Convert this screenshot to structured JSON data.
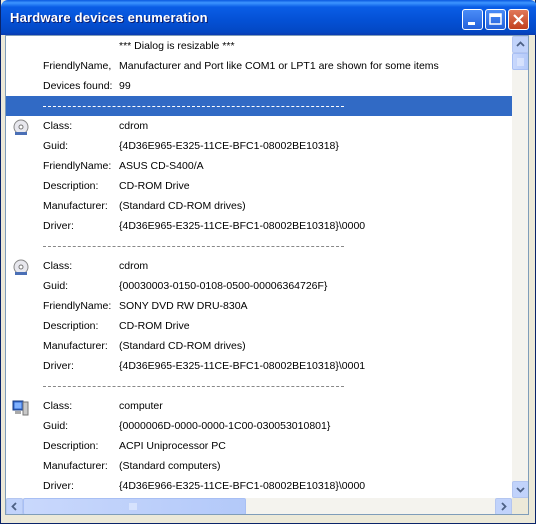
{
  "window": {
    "title": "Hardware devices enumeration"
  },
  "header": [
    {
      "label": "",
      "value": "*** Dialog is resizable ***"
    },
    {
      "label": "FriendlyName,",
      "value": "Manufacturer and Port like COM1 or LPT1 are shown for some items"
    },
    {
      "label": "Devices found:",
      "value": "99"
    }
  ],
  "separator_text": "------------------------------------------------------------------------------------------------------------------------",
  "devices": [
    {
      "icon": "cdrom-icon",
      "fields": [
        {
          "label": "Class:",
          "value": "cdrom"
        },
        {
          "label": "Guid:",
          "value": "{4D36E965-E325-11CE-BFC1-08002BE10318}"
        },
        {
          "label": "FriendlyName:",
          "value": "ASUS CD-S400/A"
        },
        {
          "label": "Description:",
          "value": "CD-ROM Drive"
        },
        {
          "label": "Manufacturer:",
          "value": "(Standard CD-ROM drives)"
        },
        {
          "label": "Driver:",
          "value": "{4D36E965-E325-11CE-BFC1-08002BE10318}\\0000"
        }
      ]
    },
    {
      "icon": "cdrom-icon",
      "fields": [
        {
          "label": "Class:",
          "value": "cdrom"
        },
        {
          "label": "Guid:",
          "value": "{00030003-0150-0108-0500-00006364726F}"
        },
        {
          "label": "FriendlyName:",
          "value": "SONY DVD RW DRU-830A"
        },
        {
          "label": "Description:",
          "value": "CD-ROM Drive"
        },
        {
          "label": "Manufacturer:",
          "value": "(Standard CD-ROM drives)"
        },
        {
          "label": "Driver:",
          "value": "{4D36E965-E325-11CE-BFC1-08002BE10318}\\0001"
        }
      ]
    },
    {
      "icon": "computer-icon",
      "fields": [
        {
          "label": "Class:",
          "value": "computer"
        },
        {
          "label": "Guid:",
          "value": "{0000006D-0000-0000-1C00-030053010801}"
        },
        {
          "label": "Description:",
          "value": "ACPI Uniprocessor PC"
        },
        {
          "label": "Manufacturer:",
          "value": "(Standard computers)"
        },
        {
          "label": "Driver:",
          "value": "{4D36E966-E325-11CE-BFC1-08002BE10318}\\0000"
        }
      ]
    }
  ],
  "colors": {
    "selection": "#316ac5",
    "titlebar": "#0450d4"
  }
}
